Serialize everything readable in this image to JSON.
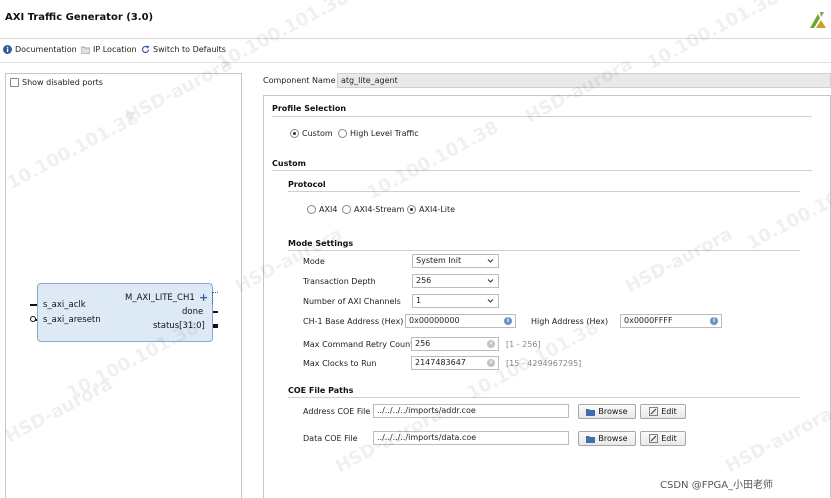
{
  "window": {
    "title": "AXI Traffic Generator (3.0)",
    "logo_icon": "vivado-logo-icon"
  },
  "toolbar": {
    "documentation": "Documentation",
    "ip_location": "IP Location",
    "switch_defaults": "Switch to Defaults"
  },
  "left_panel": {
    "show_disabled_ports": "Show disabled ports",
    "block": {
      "left_ports": [
        "s_axi_aclk",
        "s_axi_aresetn"
      ],
      "right_ports": [
        "M_AXI_LITE_CH1",
        "done",
        "status[31:0]"
      ]
    }
  },
  "component": {
    "label": "Component Name",
    "value": "atg_lite_agent"
  },
  "profile": {
    "header": "Profile Selection",
    "options": [
      "Custom",
      "High Level Traffic"
    ],
    "selected": "Custom"
  },
  "custom": {
    "header": "Custom",
    "protocol": {
      "header": "Protocol",
      "options": [
        "AXI4",
        "AXI4-Stream",
        "AXI4-Lite"
      ],
      "selected": "AXI4-Lite"
    },
    "mode_settings": {
      "header": "Mode Settings",
      "mode": {
        "label": "Mode",
        "value": "System Init"
      },
      "transaction_depth": {
        "label": "Transaction Depth",
        "value": "256"
      },
      "axi_channels": {
        "label": "Number of AXI Channels",
        "value": "1"
      },
      "base_address": {
        "label": "CH-1 Base Address (Hex)",
        "value": "0x00000000"
      },
      "high_address": {
        "label": "High Address (Hex)",
        "value": "0x0000FFFF"
      },
      "retry_count": {
        "label": "Max Command Retry Count",
        "value": "256",
        "range": "[1 - 256]"
      },
      "max_clocks": {
        "label": "Max Clocks to Run",
        "value": "2147483647",
        "range": "[15 - 4294967295]"
      }
    },
    "coe": {
      "header": "COE File Paths",
      "address": {
        "label": "Address COE File",
        "value": "../../../../imports/addr.coe"
      },
      "data": {
        "label": "Data COE File",
        "value": "../../../../imports/data.coe"
      },
      "browse_label": "Browse",
      "edit_label": "Edit"
    }
  },
  "watermark": {
    "texts": [
      "HSD-aurora",
      "10.100.101.38"
    ],
    "csdn": "CSDN @FPGA_小田老师"
  },
  "colors": {
    "block_fill": "#ddeaf6",
    "block_border": "#8aa9c8",
    "info_blue": "#6a92c7"
  }
}
